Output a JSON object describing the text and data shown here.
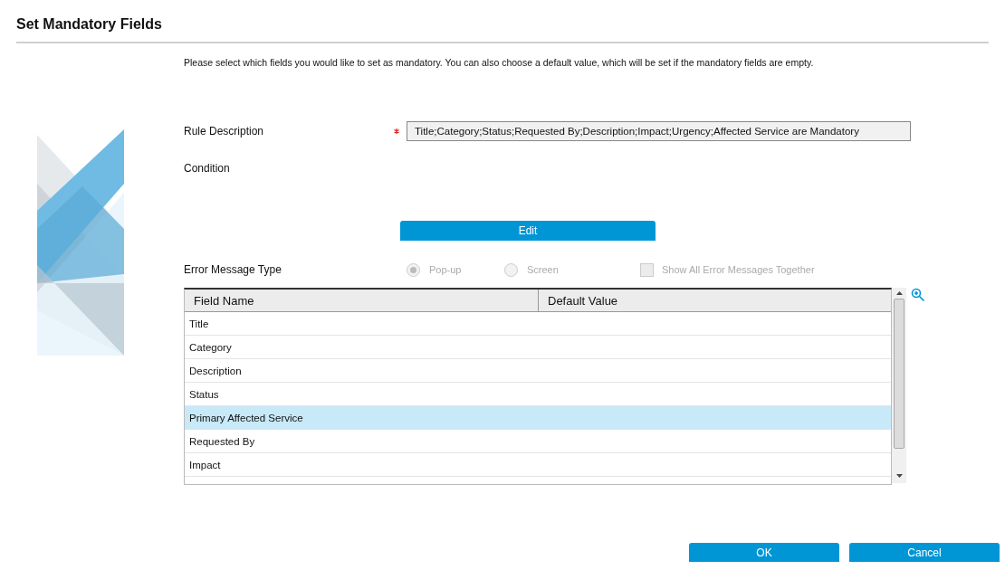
{
  "title": "Set Mandatory Fields",
  "instructions": "Please select which fields you would like to set as mandatory. You can also choose a default value, which will be set if the mandatory fields are empty.",
  "rule_description": {
    "label": "Rule Description",
    "required": true,
    "value": "Title;Category;Status;Requested By;Description;Impact;Urgency;Affected Service are Mandatory"
  },
  "condition": {
    "label": "Condition"
  },
  "edit_button": "Edit",
  "error_message_type": {
    "label": "Error Message Type",
    "disabled": true,
    "options": [
      {
        "label": "Pop-up",
        "selected": true
      },
      {
        "label": "Screen",
        "selected": false
      }
    ],
    "show_all": {
      "label": "Show All Error Messages Together",
      "checked": false
    }
  },
  "table": {
    "columns": [
      "Field Name",
      "Default Value"
    ],
    "rows": [
      {
        "field_name": "Title",
        "selected": false
      },
      {
        "field_name": "Category",
        "selected": false
      },
      {
        "field_name": "Description",
        "selected": false
      },
      {
        "field_name": "Status",
        "selected": false
      },
      {
        "field_name": "Primary Affected Service",
        "selected": true
      },
      {
        "field_name": "Requested By",
        "selected": false
      },
      {
        "field_name": "Impact",
        "selected": false
      }
    ]
  },
  "buttons": [
    "OK",
    "Cancel"
  ]
}
